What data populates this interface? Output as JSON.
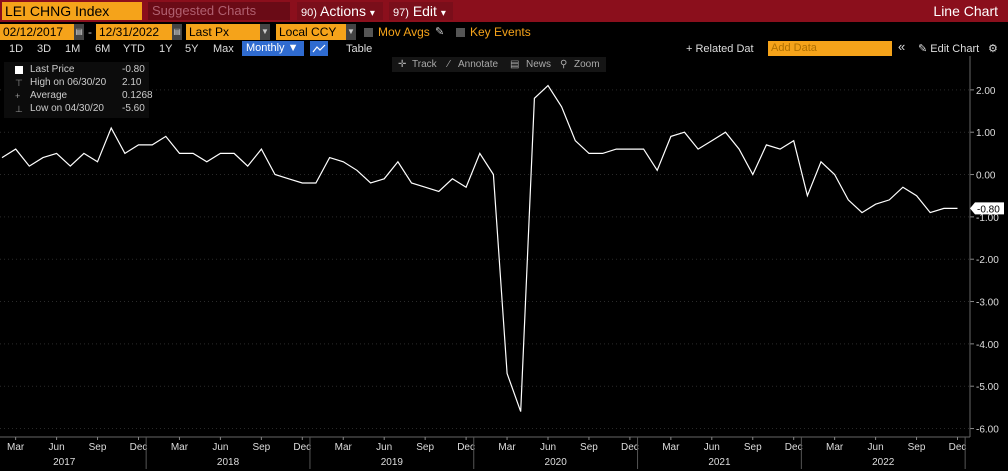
{
  "header": {
    "ticker": "LEI CHNG Index",
    "suggested_label": "Suggested Charts",
    "actions_label": "Actions",
    "actions_num": "90",
    "edit_label": "Edit",
    "edit_num": "97",
    "chart_name": "Line Chart",
    "arrow": "▾"
  },
  "controls": {
    "start_date": "02/12/2017",
    "dash": "-",
    "end_date": "12/31/2022",
    "price_field": "Last Px",
    "currency": "Local CCY",
    "mov_avgs": "Mov Avgs",
    "key_events": "Key Events",
    "ranges": [
      "1D",
      "3D",
      "1M",
      "6M",
      "YTD",
      "1Y",
      "5Y",
      "Max"
    ],
    "frequency": "Monthly ▼",
    "table_label": "Table",
    "related_label": "+ Related Dat",
    "add_data_placeholder": "Add Data",
    "collapse": "«",
    "edit_chart": "✎ Edit Chart",
    "settings_icon": "⚙"
  },
  "toolbar": {
    "track": "Track",
    "annotate": "Annotate",
    "news": "News",
    "zoom": "Zoom"
  },
  "legend": {
    "last_price_label": "Last Price",
    "last_price_value": "-0.80",
    "high_label": "High on 06/30/20",
    "high_value": "2.10",
    "average_label": "Average",
    "average_value": "0.1268",
    "low_label": "Low on 04/30/20",
    "low_value": "-5.60"
  },
  "colors": {
    "top_bar": "#8b0f1c",
    "accent_orange": "#f5a31a",
    "selected_blue": "#2f6bd0",
    "line": "#ffffff",
    "background": "#000000"
  },
  "chart_data": {
    "type": "line",
    "series": [
      {
        "name": "Last Price",
        "x": [
          "2017-02",
          "2017-03",
          "2017-04",
          "2017-05",
          "2017-06",
          "2017-07",
          "2017-08",
          "2017-09",
          "2017-10",
          "2017-11",
          "2017-12",
          "2018-01",
          "2018-02",
          "2018-03",
          "2018-04",
          "2018-05",
          "2018-06",
          "2018-07",
          "2018-08",
          "2018-09",
          "2018-10",
          "2018-11",
          "2018-12",
          "2019-01",
          "2019-02",
          "2019-03",
          "2019-04",
          "2019-05",
          "2019-06",
          "2019-07",
          "2019-08",
          "2019-09",
          "2019-10",
          "2019-11",
          "2019-12",
          "2020-01",
          "2020-02",
          "2020-03",
          "2020-04",
          "2020-05",
          "2020-06",
          "2020-07",
          "2020-08",
          "2020-09",
          "2020-10",
          "2020-11",
          "2020-12",
          "2021-01",
          "2021-02",
          "2021-03",
          "2021-04",
          "2021-05",
          "2021-06",
          "2021-07",
          "2021-08",
          "2021-09",
          "2021-10",
          "2021-11",
          "2021-12",
          "2022-01",
          "2022-02",
          "2022-03",
          "2022-04",
          "2022-05",
          "2022-06",
          "2022-07",
          "2022-08",
          "2022-09",
          "2022-10",
          "2022-11",
          "2022-12"
        ],
        "values": [
          0.4,
          0.6,
          0.2,
          0.4,
          0.5,
          0.2,
          0.5,
          0.3,
          1.1,
          0.5,
          0.7,
          0.7,
          0.9,
          0.5,
          0.5,
          0.3,
          0.5,
          0.5,
          0.2,
          0.6,
          0.0,
          -0.1,
          -0.2,
          -0.2,
          0.4,
          0.3,
          0.1,
          -0.2,
          -0.1,
          0.3,
          -0.2,
          -0.3,
          -0.4,
          -0.1,
          -0.3,
          0.5,
          0.0,
          -4.7,
          -5.6,
          1.8,
          2.1,
          1.6,
          0.8,
          0.5,
          0.5,
          0.6,
          0.6,
          0.6,
          0.1,
          0.9,
          1.0,
          0.6,
          0.8,
          1.0,
          0.6,
          0.0,
          0.7,
          0.6,
          0.8,
          -0.5,
          0.3,
          0.0,
          -0.6,
          -0.9,
          -0.7,
          -0.6,
          -0.3,
          -0.5,
          -0.9,
          -0.8,
          -0.8
        ]
      }
    ],
    "ylim": [
      -6.2,
      2.8
    ],
    "yticks": [
      "2.00",
      "1.00",
      "0.00",
      "-1.00",
      "-2.00",
      "-3.00",
      "-4.00",
      "-5.00",
      "-6.00"
    ],
    "month_ticks": [
      "Mar",
      "Jun",
      "Sep",
      "Dec"
    ],
    "year_labels": [
      "2017",
      "2018",
      "2019",
      "2020",
      "2021",
      "2022"
    ],
    "last_value_label": "-0.80",
    "grid": true
  }
}
